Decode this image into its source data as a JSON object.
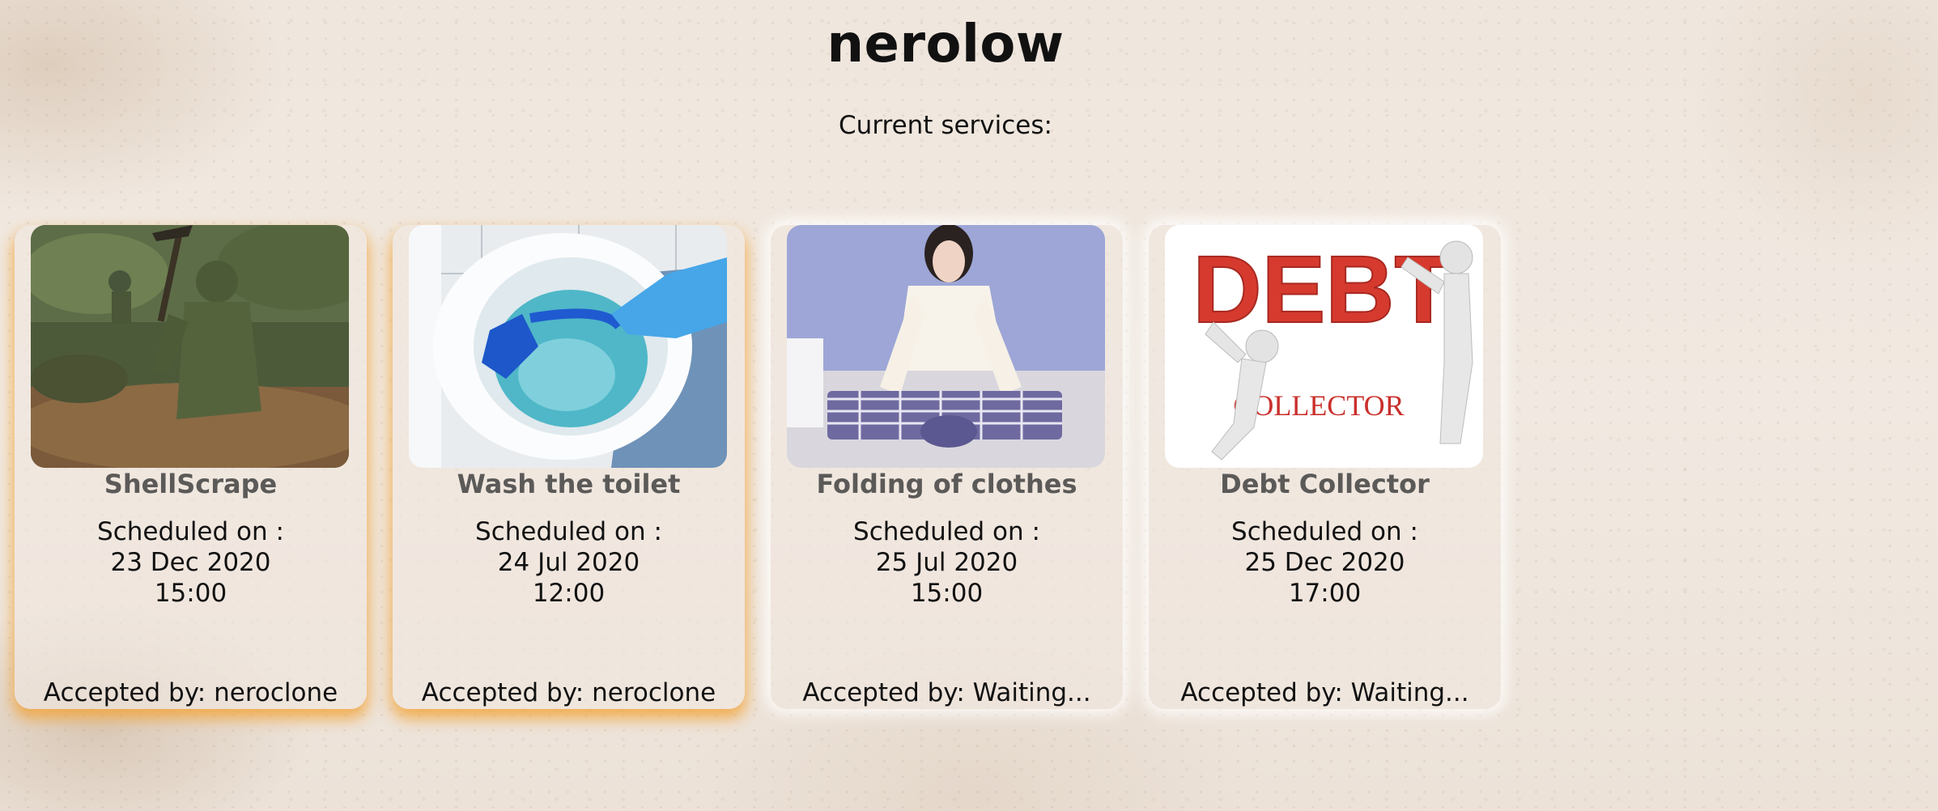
{
  "page": {
    "title": "nerolow",
    "subtitle": "Current services:"
  },
  "colors": {
    "accepted_glow": "#f3a132",
    "waiting_glow": "#ffffff",
    "service_name": "#5b5a58"
  },
  "services": [
    {
      "name": "ShellScrape",
      "scheduled_label": "Scheduled on :",
      "date": "23 Dec 2020",
      "time": "15:00",
      "accepted_by": "Accepted by: neroclone",
      "status": "accepted",
      "image": "soldier-digging-image"
    },
    {
      "name": "Wash the toilet",
      "scheduled_label": "Scheduled on :",
      "date": "24 Jul 2020",
      "time": "12:00",
      "accepted_by": "Accepted by: neroclone",
      "status": "accepted",
      "image": "toilet-brush-image"
    },
    {
      "name": "Folding of clothes",
      "scheduled_label": "Scheduled on :",
      "date": "25 Jul 2020",
      "time": "15:00",
      "accepted_by": "Accepted by: Waiting...",
      "status": "waiting",
      "image": "folding-clothes-image"
    },
    {
      "name": "Debt Collector",
      "scheduled_label": "Scheduled on :",
      "date": "25 Dec 2020",
      "time": "17:00",
      "accepted_by": "Accepted by: Waiting...",
      "status": "waiting",
      "image": "debt-collector-image",
      "image_text": {
        "big": "DEBT",
        "small": "COLLECTOR"
      }
    }
  ]
}
